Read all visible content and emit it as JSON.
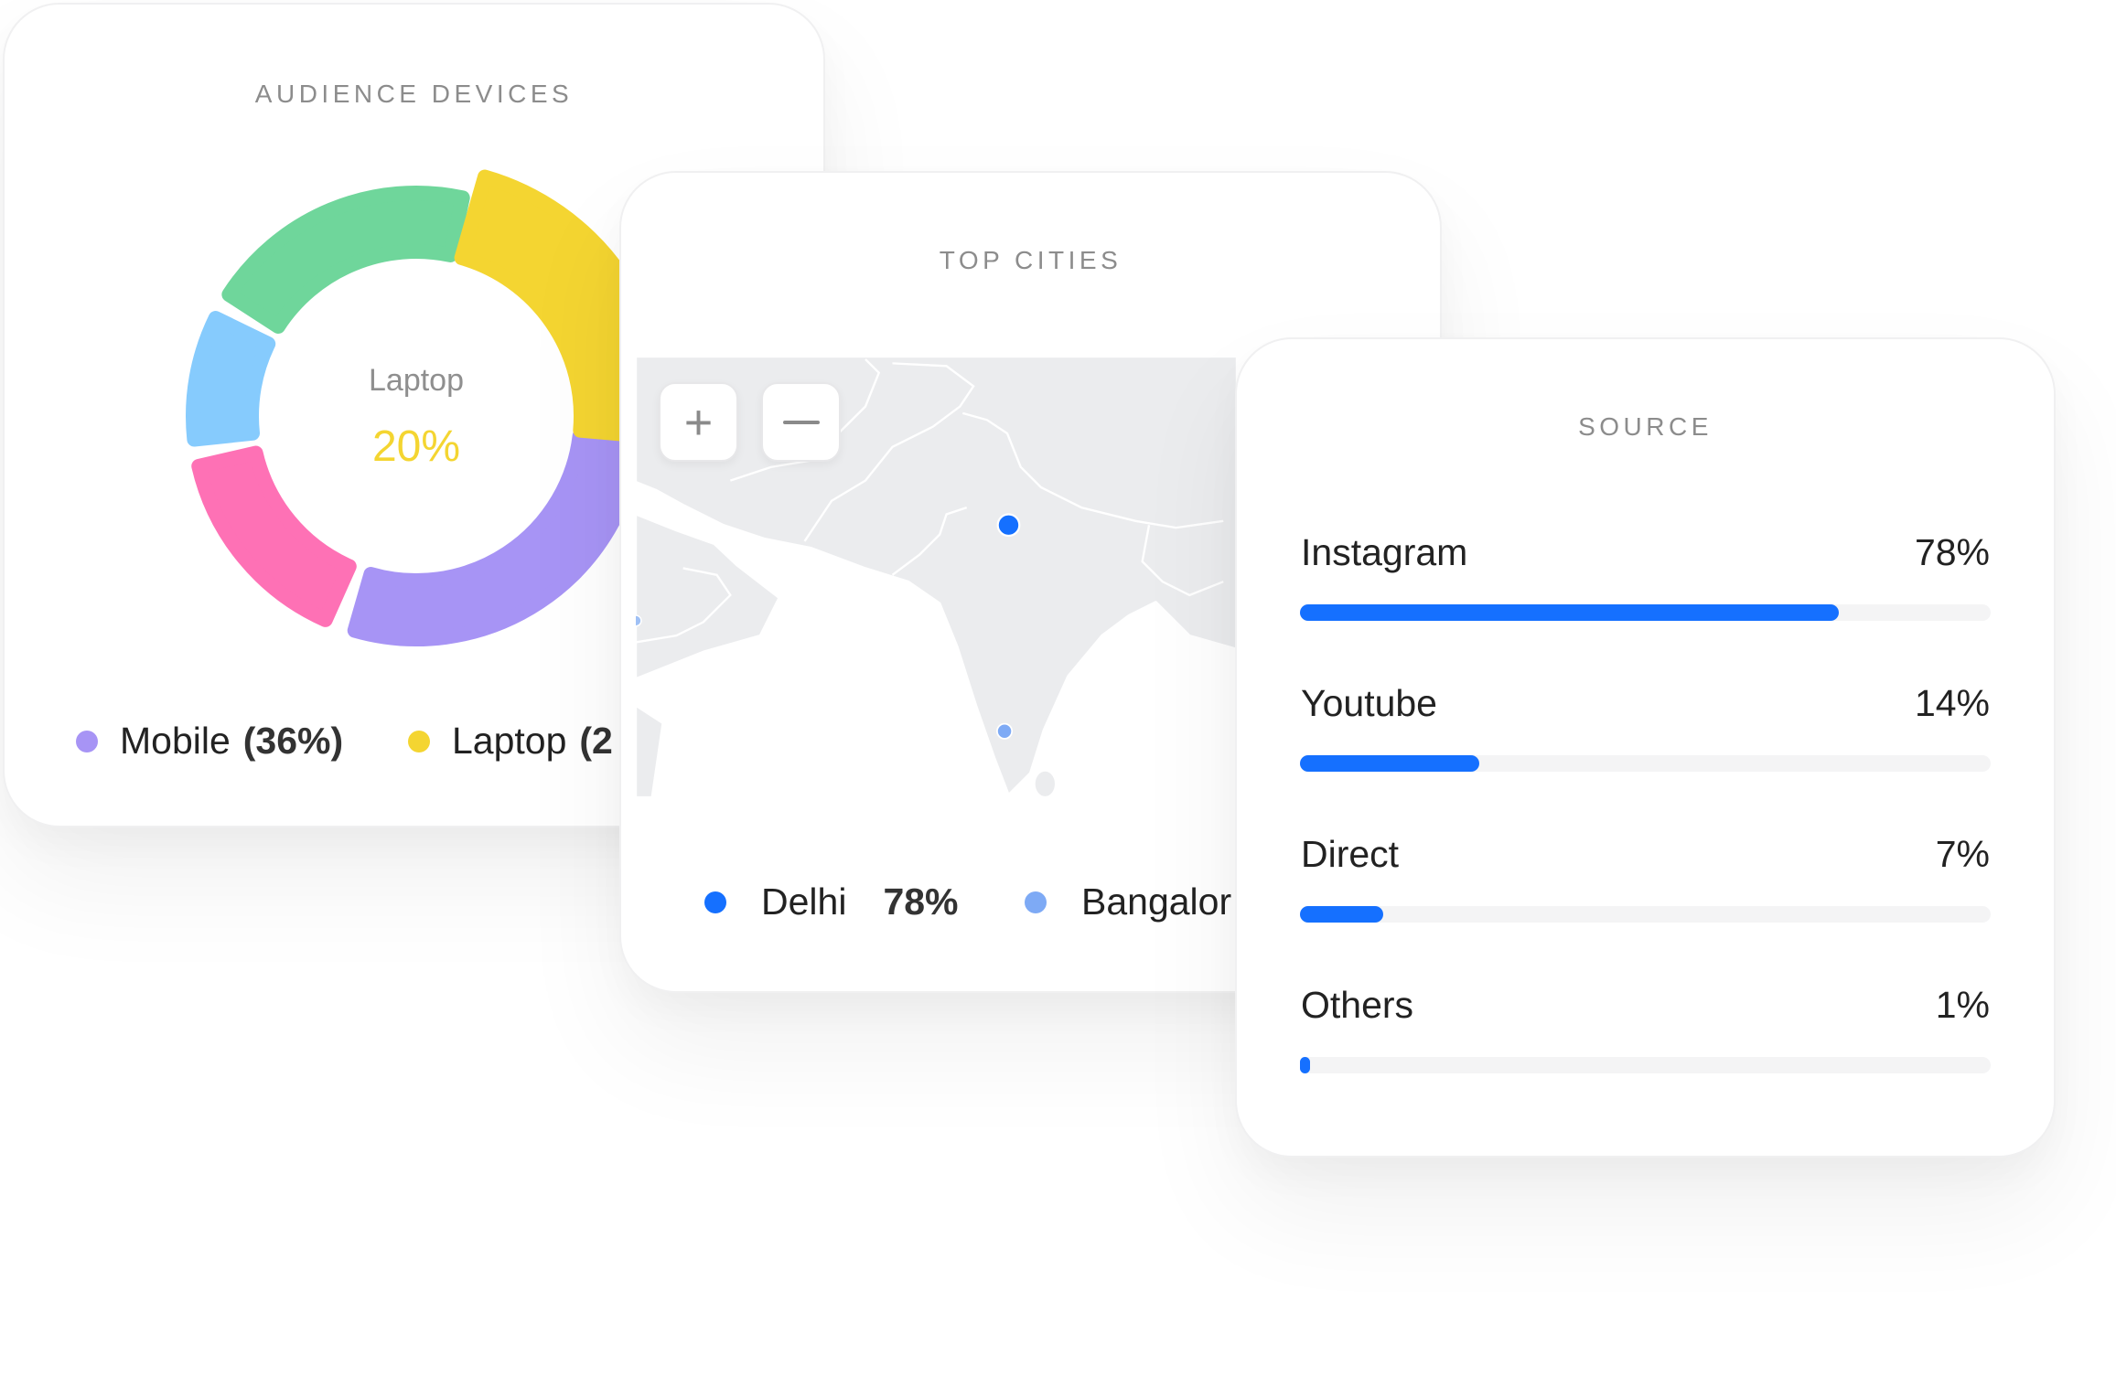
{
  "devices": {
    "title": "AUDIENCE DEVICES",
    "center_label": "Laptop",
    "center_value": "20%",
    "center_value_color": "#f4d531",
    "legend": [
      {
        "label": "Mobile",
        "value": "(36%)",
        "color": "#a794f5"
      },
      {
        "label": "Laptop",
        "value": "(2",
        "color": "#f4d531"
      }
    ]
  },
  "chart_data": {
    "type": "pie",
    "title": "AUDIENCE DEVICES",
    "segments": [
      {
        "name": "Laptop",
        "value": 20,
        "color": "#f4d531",
        "highlighted": true
      },
      {
        "name": "Mobile",
        "value": 36,
        "color": "#a794f5"
      },
      {
        "value": 15,
        "color": "#fe71b5"
      },
      {
        "value": 10,
        "color": "#86cbfd"
      },
      {
        "value": 19,
        "color": "#6fd69b"
      }
    ]
  },
  "cities": {
    "title": "TOP CITIES",
    "zoom_in_icon": "plus-icon",
    "zoom_out_icon": "minus-icon",
    "land_color": "#ebecee",
    "legend": [
      {
        "label": "Delhi",
        "value": "78%",
        "color": "#1570ff"
      },
      {
        "label": "Bangalor",
        "value": "",
        "color": "#7eaaf5"
      }
    ]
  },
  "source": {
    "title": "SOURCE",
    "accent": "#1570ff",
    "rows": [
      {
        "label": "Instagram",
        "value": "78%",
        "fill": 0.78
      },
      {
        "label": "Youtube",
        "value": "14%",
        "fill": 0.26
      },
      {
        "label": "Direct",
        "value": "7%",
        "fill": 0.12
      },
      {
        "label": "Others",
        "value": "1%",
        "fill": 0.015
      }
    ]
  }
}
